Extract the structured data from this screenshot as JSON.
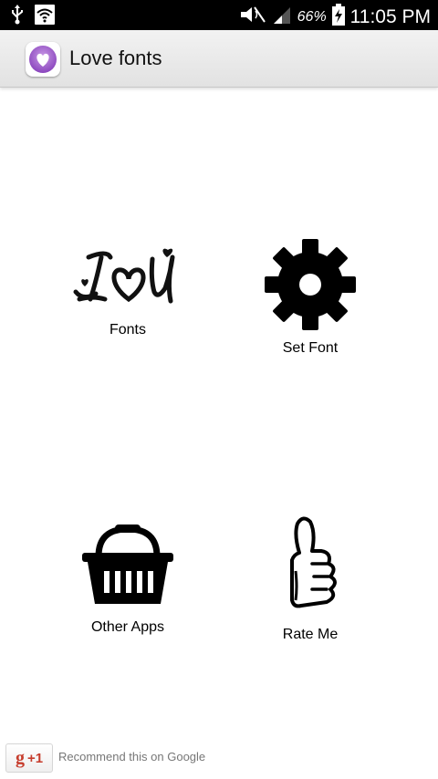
{
  "status_bar": {
    "battery_percent": "66%",
    "time": "11:05 PM",
    "icons": [
      "usb-icon",
      "wifi-icon",
      "mute-icon",
      "signal-icon",
      "battery-charging-icon"
    ]
  },
  "action_bar": {
    "title": "Love fonts",
    "icon": "heart-icon"
  },
  "grid": {
    "items": [
      {
        "label": "Fonts",
        "icon": "love-you-icon"
      },
      {
        "label": "Set Font",
        "icon": "gear-icon"
      },
      {
        "label": "Other Apps",
        "icon": "basket-icon"
      },
      {
        "label": "Rate Me",
        "icon": "thumbs-up-icon"
      }
    ]
  },
  "footer": {
    "plus_one": "+1",
    "recommend_text": "Recommend this on Google"
  },
  "colors": {
    "status_bar": "#000000",
    "action_bar": "#e8e8e8",
    "app_icon_accent": "#9c5bc8",
    "google_red": "#c63d2d"
  }
}
